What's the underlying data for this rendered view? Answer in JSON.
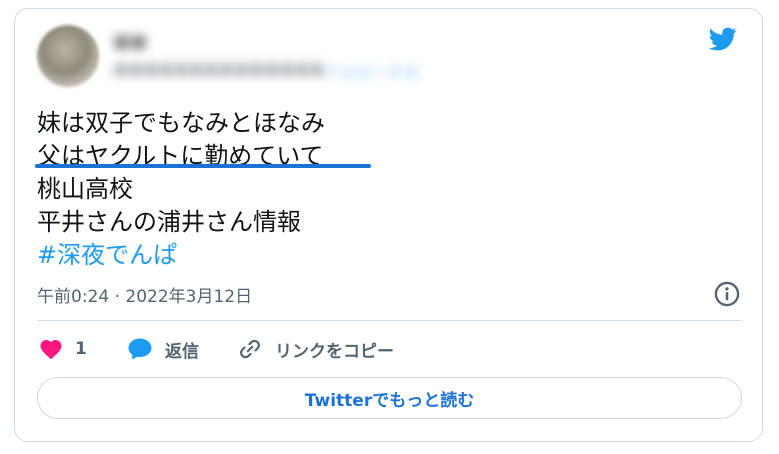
{
  "author": {
    "name": "■■",
    "handle": "■■■■■■■■■■■■■■",
    "follow_label": "フォローする"
  },
  "tweet": {
    "lines": [
      "妹は双子でもなみとほなみ",
      "父はヤクルトに勤めていて",
      "桃山高校",
      "平井さんの浦井さん情報"
    ],
    "hashtag": "#深夜でんぱ",
    "timestamp": "午前0:24 · 2022年3月12日"
  },
  "actions": {
    "like_count": "1",
    "reply_label": "返信",
    "copy_link_label": "リンクをコピー"
  },
  "read_more_label": "Twitterでもっと読む",
  "colors": {
    "twitter_blue": "#1d9bf0",
    "like_red": "#f91880",
    "underline_blue": "#1d72d6",
    "border": "#cfd9de",
    "secondary_text": "#536471"
  }
}
